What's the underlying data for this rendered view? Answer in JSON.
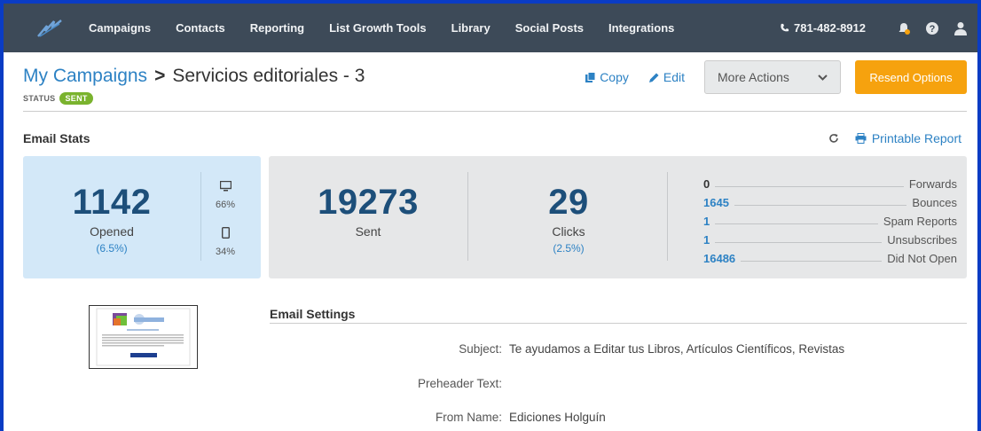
{
  "nav": {
    "items": [
      "Campaigns",
      "Contacts",
      "Reporting",
      "List Growth Tools",
      "Library",
      "Social Posts",
      "Integrations"
    ],
    "phone": "781-482-8912",
    "bg_color": "#3d4a58"
  },
  "header": {
    "breadcrumb_root": "My Campaigns",
    "separator": ">",
    "campaign_name": "Servicios editoriales - 3",
    "status_label": "STATUS",
    "status_value": "SENT"
  },
  "actions": {
    "copy": "Copy",
    "edit": "Edit",
    "more_actions": "More Actions",
    "resend": "Resend Options",
    "resend_color": "#f6a20e"
  },
  "stats": {
    "title": "Email Stats",
    "printable": "Printable Report",
    "opened": {
      "value": "1142",
      "label": "Opened",
      "pct": "(6.5%)"
    },
    "devices": {
      "desktop_pct": "66%",
      "mobile_pct": "34%"
    },
    "sent": {
      "value": "19273",
      "label": "Sent"
    },
    "clicks": {
      "value": "29",
      "label": "Clicks",
      "pct": "(2.5%)"
    },
    "mini": [
      {
        "value": "0",
        "label": "Forwards"
      },
      {
        "value": "1645",
        "label": "Bounces"
      },
      {
        "value": "1",
        "label": "Spam Reports"
      },
      {
        "value": "1",
        "label": "Unsubscribes"
      },
      {
        "value": "16486",
        "label": "Did Not Open"
      }
    ]
  },
  "settings": {
    "title": "Email Settings",
    "subject_label": "Subject:",
    "subject": "Te ayudamos a Editar tus Libros, Artículos Científicos, Revistas",
    "preheader_label": "Preheader Text:",
    "preheader": "",
    "from_label": "From Name:",
    "from_name": "Ediciones Holguín"
  },
  "icons": [
    "logo-icon",
    "phone-icon",
    "bell-icon",
    "help-icon",
    "user-icon",
    "copy-icon",
    "edit-icon",
    "chevron-down-icon",
    "refresh-icon",
    "print-icon",
    "desktop-icon",
    "mobile-icon"
  ]
}
